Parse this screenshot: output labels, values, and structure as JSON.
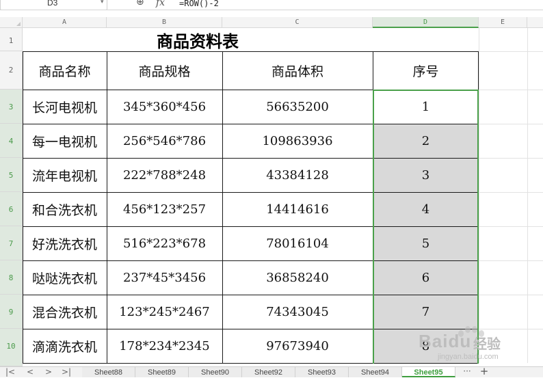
{
  "formula_bar": {
    "cell_ref": "D3",
    "fx_label": "fx",
    "formula": "=ROW()-2"
  },
  "columns": [
    "A",
    "B",
    "C",
    "D",
    "E"
  ],
  "rows": [
    "1",
    "2",
    "3",
    "4",
    "5",
    "6",
    "7",
    "8",
    "9",
    "10"
  ],
  "sheet": {
    "title": "商品资料表",
    "headers": [
      "商品名称",
      "商品规格",
      "商品体积",
      "序号"
    ],
    "data": [
      {
        "name": "长河电视机",
        "spec": "345*360*456",
        "volume": "56635200",
        "seq": "1"
      },
      {
        "name": "每一电视机",
        "spec": "256*546*786",
        "volume": "109863936",
        "seq": "2"
      },
      {
        "name": "流年电视机",
        "spec": "222*788*248",
        "volume": "43384128",
        "seq": "3"
      },
      {
        "name": "和合洗衣机",
        "spec": "456*123*257",
        "volume": "14414616",
        "seq": "4"
      },
      {
        "name": "好洗洗衣机",
        "spec": "516*223*678",
        "volume": "78016104",
        "seq": "5"
      },
      {
        "name": "哒哒洗衣机",
        "spec": "237*45*3456",
        "volume": "36858240",
        "seq": "6"
      },
      {
        "name": "混合洗衣机",
        "spec": "123*245*2467",
        "volume": "74343045",
        "seq": "7"
      },
      {
        "name": "滴滴洗衣机",
        "spec": "178*234*2345",
        "volume": "97673940",
        "seq": "8"
      }
    ]
  },
  "tabs": [
    "Sheet88",
    "Sheet89",
    "Sheet90",
    "Sheet92",
    "Sheet93",
    "Sheet94",
    "Sheet95"
  ],
  "active_tab": "Sheet95",
  "tab_controls": {
    "first": "|<",
    "prev": "<",
    "next": ">",
    "last": ">|",
    "more": "···",
    "add": "+"
  },
  "watermark": {
    "brand": "Bai",
    "brand_suffix": "du",
    "label": "经验",
    "url": "jingyan.baidu.com"
  },
  "colors": {
    "selection": "#4aa04a",
    "shaded_cells": "#d9d9d9",
    "active_tab_text": "#3e9e3e"
  },
  "icons": {
    "zoom": "zoom-icon",
    "dropdown": "chevron-down-icon"
  }
}
